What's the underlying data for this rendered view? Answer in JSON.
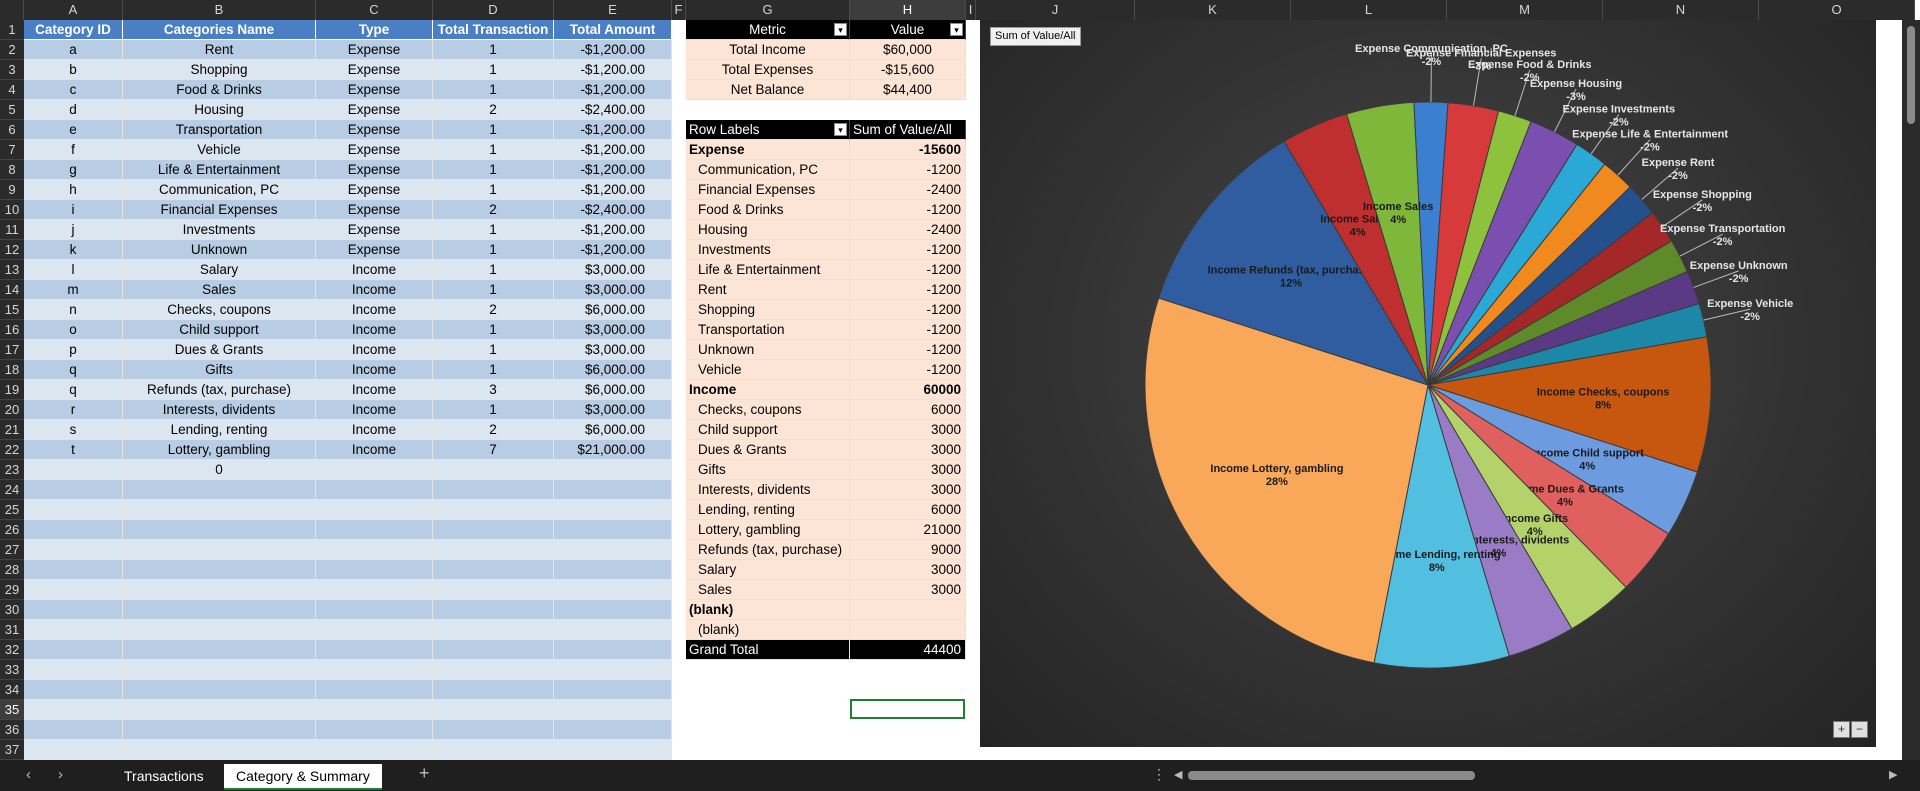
{
  "columns": [
    "A",
    "B",
    "C",
    "D",
    "E",
    "F",
    "G",
    "H",
    "I",
    "J",
    "K",
    "L",
    "M",
    "N",
    "O"
  ],
  "selected_column": "H",
  "rows_visible": [
    "1",
    "2",
    "3",
    "4",
    "5",
    "6",
    "7",
    "8",
    "9",
    "10",
    "11",
    "12",
    "13",
    "14",
    "15",
    "16",
    "17",
    "18",
    "19",
    "20",
    "21",
    "22",
    "23",
    "24",
    "25",
    "26",
    "27",
    "28",
    "29",
    "30",
    "31",
    "32",
    "33",
    "34",
    "35",
    "36",
    "37"
  ],
  "selected_row": "35",
  "table": {
    "headers": [
      "Category ID",
      "Categories Name",
      "Type",
      "Total Transaction",
      "Total Amount"
    ],
    "rows": [
      [
        "a",
        "Rent",
        "Expense",
        "1",
        "-$1,200.00"
      ],
      [
        "b",
        "Shopping",
        "Expense",
        "1",
        "-$1,200.00"
      ],
      [
        "c",
        "Food & Drinks",
        "Expense",
        "1",
        "-$1,200.00"
      ],
      [
        "d",
        "Housing",
        "Expense",
        "2",
        "-$2,400.00"
      ],
      [
        "e",
        "Transportation",
        "Expense",
        "1",
        "-$1,200.00"
      ],
      [
        "f",
        "Vehicle",
        "Expense",
        "1",
        "-$1,200.00"
      ],
      [
        "g",
        "Life & Entertainment",
        "Expense",
        "1",
        "-$1,200.00"
      ],
      [
        "h",
        "Communication, PC",
        "Expense",
        "1",
        "-$1,200.00"
      ],
      [
        "i",
        "Financial Expenses",
        "Expense",
        "2",
        "-$2,400.00"
      ],
      [
        "j",
        "Investments",
        "Expense",
        "1",
        "-$1,200.00"
      ],
      [
        "k",
        "Unknown",
        "Expense",
        "1",
        "-$1,200.00"
      ],
      [
        "l",
        "Salary",
        "Income",
        "1",
        "$3,000.00"
      ],
      [
        "m",
        "Sales",
        "Income",
        "1",
        "$3,000.00"
      ],
      [
        "n",
        "Checks, coupons",
        "Income",
        "2",
        "$6,000.00"
      ],
      [
        "o",
        "Child support",
        "Income",
        "1",
        "$3,000.00"
      ],
      [
        "p",
        "Dues & Grants",
        "Income",
        "1",
        "$3,000.00"
      ],
      [
        "q",
        "Gifts",
        "Income",
        "1",
        "$6,000.00"
      ],
      [
        "q",
        "Refunds (tax, purchase)",
        "Income",
        "3",
        "$6,000.00"
      ],
      [
        "r",
        "Interests, dividents",
        "Income",
        "1",
        "$3,000.00"
      ],
      [
        "s",
        "Lending, renting",
        "Income",
        "2",
        "$6,000.00"
      ],
      [
        "t",
        "Lottery, gambling",
        "Income",
        "7",
        "$21,000.00"
      ],
      [
        "",
        "0",
        "",
        "",
        ""
      ]
    ]
  },
  "metrics": {
    "headers": [
      "Metric",
      "Value"
    ],
    "rows": [
      [
        "Total Income",
        "$60,000"
      ],
      [
        "Total Expenses",
        "-$15,600"
      ],
      [
        "Net Balance",
        "$44,400"
      ]
    ]
  },
  "pivot": {
    "headers": [
      "Row Labels",
      "Sum of Value/All"
    ],
    "rows": [
      {
        "label": "Expense",
        "value": "-15600",
        "bold": true
      },
      {
        "label": "Communication, PC",
        "value": "-1200",
        "indent": true
      },
      {
        "label": "Financial Expenses",
        "value": "-2400",
        "indent": true
      },
      {
        "label": "Food & Drinks",
        "value": "-1200",
        "indent": true
      },
      {
        "label": "Housing",
        "value": "-2400",
        "indent": true
      },
      {
        "label": "Investments",
        "value": "-1200",
        "indent": true
      },
      {
        "label": "Life & Entertainment",
        "value": "-1200",
        "indent": true
      },
      {
        "label": "Rent",
        "value": "-1200",
        "indent": true
      },
      {
        "label": "Shopping",
        "value": "-1200",
        "indent": true
      },
      {
        "label": "Transportation",
        "value": "-1200",
        "indent": true
      },
      {
        "label": "Unknown",
        "value": "-1200",
        "indent": true
      },
      {
        "label": "Vehicle",
        "value": "-1200",
        "indent": true
      },
      {
        "label": "Income",
        "value": "60000",
        "bold": true
      },
      {
        "label": "Checks, coupons",
        "value": "6000",
        "indent": true
      },
      {
        "label": "Child support",
        "value": "3000",
        "indent": true
      },
      {
        "label": "Dues & Grants",
        "value": "3000",
        "indent": true
      },
      {
        "label": "Gifts",
        "value": "3000",
        "indent": true
      },
      {
        "label": "Interests, dividents",
        "value": "3000",
        "indent": true
      },
      {
        "label": "Lending, renting",
        "value": "6000",
        "indent": true
      },
      {
        "label": "Lottery, gambling",
        "value": "21000",
        "indent": true
      },
      {
        "label": "Refunds (tax, purchase)",
        "value": "9000",
        "indent": true
      },
      {
        "label": "Salary",
        "value": "3000",
        "indent": true
      },
      {
        "label": "Sales",
        "value": "3000",
        "indent": true
      },
      {
        "label": "(blank)",
        "value": "",
        "bold": true
      },
      {
        "label": "(blank)",
        "value": "",
        "indent": true
      }
    ],
    "grand_total_label": "Grand Total",
    "grand_total_value": "44400"
  },
  "chart_button": "Sum of Value/All",
  "chart_data": {
    "type": "pie",
    "title": "",
    "slices": [
      {
        "label": "Expense Communication, PC",
        "percent": -2,
        "color": "#3a7fd0"
      },
      {
        "label": "Expense Financial Expenses",
        "percent": -3,
        "color": "#d63a3a"
      },
      {
        "label": "Expense Food & Drinks",
        "percent": -2,
        "color": "#8fc23c"
      },
      {
        "label": "Expense Housing",
        "percent": -3,
        "color": "#7b4fb0"
      },
      {
        "label": "Expense Investments",
        "percent": -2,
        "color": "#2ba9d6"
      },
      {
        "label": "Expense Life & Entertainment",
        "percent": -2,
        "color": "#f08a1e"
      },
      {
        "label": "Expense Rent",
        "percent": -2,
        "color": "#24518c"
      },
      {
        "label": "Expense Shopping",
        "percent": -2,
        "color": "#a52828"
      },
      {
        "label": "Expense Transportation",
        "percent": -2,
        "color": "#5e8a2a"
      },
      {
        "label": "Expense Unknown",
        "percent": -2,
        "color": "#5a3a85"
      },
      {
        "label": "Expense Vehicle",
        "percent": -2,
        "color": "#1d87a8"
      },
      {
        "label": "Income Checks, coupons",
        "percent": 8,
        "color": "#c7560f"
      },
      {
        "label": "Income Child support",
        "percent": 4,
        "color": "#6d9be0"
      },
      {
        "label": "Income Dues & Grants",
        "percent": 4,
        "color": "#e06060"
      },
      {
        "label": "Income Gifts",
        "percent": 4,
        "color": "#b4d26a"
      },
      {
        "label": "Income Interests, dividents",
        "percent": 4,
        "color": "#9a7cc6"
      },
      {
        "label": "Income Lending, renting",
        "percent": 8,
        "color": "#52bfe0"
      },
      {
        "label": "Income Lottery, gambling",
        "percent": 28,
        "color": "#f9a859"
      },
      {
        "label": "Income Refunds (tax, purchase)",
        "percent": 12,
        "color": "#2f5da0"
      },
      {
        "label": "Income Salary",
        "percent": 4,
        "color": "#c02f2f"
      },
      {
        "label": "Income Sales",
        "percent": 4,
        "color": "#7fb73a"
      }
    ]
  },
  "tabs": [
    "Transactions",
    "Category & Summary"
  ],
  "active_tab": "Category & Summary",
  "icons": {
    "nav_prev": "chevron-left-icon",
    "nav_next": "chevron-right-icon",
    "add_sheet": "plus-icon",
    "more": "more-vertical-icon",
    "zoom_in": "plus-icon",
    "zoom_out": "minus-icon"
  }
}
